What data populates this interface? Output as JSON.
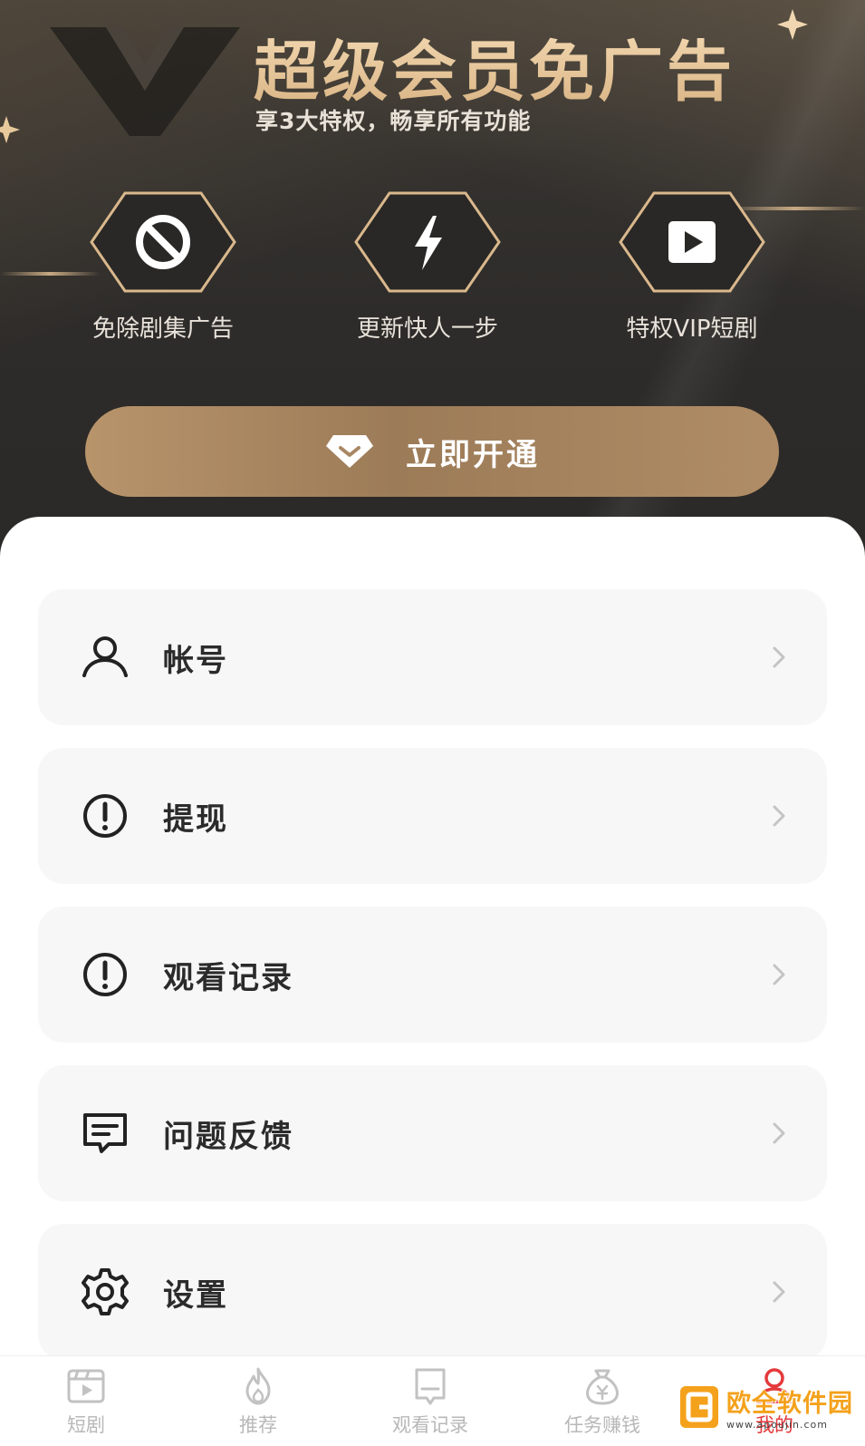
{
  "vip_banner": {
    "title": "超级会员免广告",
    "subtitle": "享3大特权，畅享所有功能",
    "perks": [
      {
        "label": "免除剧集广告",
        "icon": "no-ads-icon"
      },
      {
        "label": "更新快人一步",
        "icon": "lightning-icon"
      },
      {
        "label": "特权VIP短剧",
        "icon": "play-icon"
      }
    ],
    "cta_label": "立即开通",
    "cta_icon": "diamond-icon"
  },
  "menu": {
    "items": [
      {
        "label": "帐号",
        "icon": "user-icon"
      },
      {
        "label": "提现",
        "icon": "alert-circle-icon"
      },
      {
        "label": "观看记录",
        "icon": "alert-circle-icon"
      },
      {
        "label": "问题反馈",
        "icon": "message-icon"
      },
      {
        "label": "设置",
        "icon": "gear-icon"
      }
    ]
  },
  "tabbar": {
    "tabs": [
      {
        "label": "短剧",
        "icon": "video-icon",
        "active": false
      },
      {
        "label": "推荐",
        "icon": "flame-icon",
        "active": false
      },
      {
        "label": "观看记录",
        "icon": "bookmark-icon",
        "active": false
      },
      {
        "label": "任务赚钱",
        "icon": "money-bag-icon",
        "active": false
      },
      {
        "label": "我的",
        "icon": "profile-icon",
        "active": true
      }
    ]
  },
  "watermark": {
    "name": "欧全软件园",
    "domain": "www.apoujin.com"
  },
  "colors": {
    "gold": "#d8b383",
    "cta": "#a98763",
    "active_tab": "#e4393c",
    "inactive_tab": "#b8b8b8"
  }
}
